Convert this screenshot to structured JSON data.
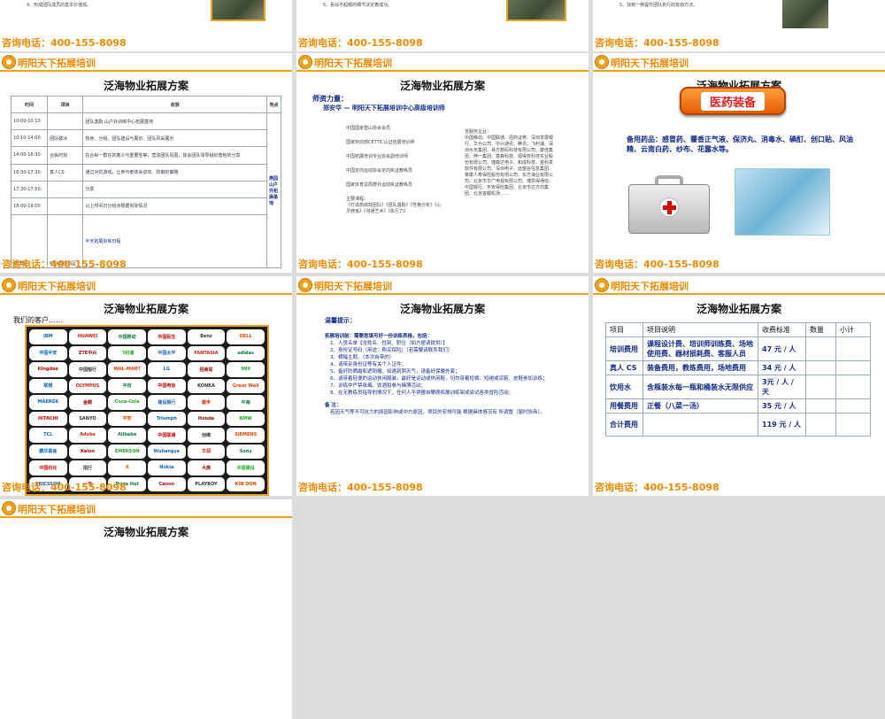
{
  "brand": "明阳天下拓展培训",
  "phone": "咨询电话：400-155-8098",
  "slide_title": "泛海物业拓展方案",
  "row0": {
    "s1_text": "4、形成团队成员的基本价值观。",
    "s2_text": "5、看似不起眼的细节决定着成功。",
    "s3_text": "5、找到一种提升团队执行的有效方法。"
  },
  "schedule": {
    "headers": [
      "时间",
      "项目",
      "收获",
      "地点"
    ],
    "side_label": "半天拓展训练日程",
    "rows": [
      [
        "10:00-10:10",
        "",
        "团队激励 山户外训练中心拓展基地",
        ""
      ],
      [
        "10:10-14:00",
        "团队破冰",
        "热身、分组、团队建设与展示、团队风采展示",
        ""
      ],
      [
        "14:00-16:30",
        "合纵时刻",
        "在合纵一群在的着义与重要性等，营造团队氛围，体会团队领导组织角色的分享",
        ""
      ],
      [
        "16:30-17:30",
        "真人CS",
        "通过对抗游戏，让参与者体会进攻、防御的策略",
        ""
      ],
      [
        "17:30-17:50",
        "",
        "分享",
        ""
      ],
      [
        "18:00-19:00",
        "",
        "以上时间日分班点根据实际情况",
        ""
      ]
    ],
    "place": "燕园山户外拓展基地",
    "end_time": "18:50",
    "end_text": "结队返回市区"
  },
  "trainer": {
    "section": "师资力量：",
    "name": "郑安华 — 明阳天下拓展培训中心高级培训师",
    "left_lines": [
      "中国国家登山协会会员",
      "国家劳动部CETTIC认证拓展培训师",
      "中国拓展培训专业协会副培训师",
      "中国定向运动协会定向执证教练员",
      "国家体育总局野外运动执证教练员"
    ],
    "courses_label": "主要课程：",
    "courses": "《打造高绩效团队》《团队激励》《性格分析》《心灵修炼》《沟通艺术》《执行力》",
    "right_head": "曾服务企业：",
    "right_text": "中国移动、中国联通、招商证券、深圳发展银行、华为公司、中兴通讯、腾讯、飞利浦、深圳水务集团、易方数码科技有限公司、康佳集团、伸一集团、富森科技、视得安科技实业股份有限公司、捷森达电子、和成科技、金科发软件有限公司、深圳电子、远望谷信息集团、泰康人寿保险股份有限公司、东方海业有限公司、北京市华广电视有限公司、博思得通信、中国银行、平安保险集团、北京市达方向集团、北京首都机场……"
  },
  "medical": {
    "button": "医药装备",
    "label": "备用药品：",
    "items": "感冒药、藿香正气液、保济丸、消毒水、碘酊、创口贴、风油精、云南白药、纱布、花露水等。"
  },
  "clients": {
    "heading": "我们的客户……",
    "logos": [
      "IBM",
      "HUAWEI",
      "中国移动",
      "中国民生",
      "Benz",
      "DELL",
      "中国平安",
      "ZTE中兴",
      "飞利浦",
      "中国太平",
      "FANTASIA",
      "adidas",
      "Kingdee",
      "中国银行",
      "WAL-MART",
      "LG",
      "招商局",
      "999",
      "联想",
      "OLYMPUS",
      "中信",
      "中国电信",
      "KONKA",
      "Great Wall",
      "MAERSK",
      "金蝶",
      "Coca-Cola",
      "建设银行",
      "顺丰",
      "中海",
      "HITACHI",
      "SANYO",
      "平安",
      "Triumph",
      "Honda",
      "BMW",
      "TCL",
      "Adobe",
      "Alibaba",
      "中国联通",
      "创维",
      "SIEMENS",
      "鹏华基金",
      "Kelon",
      "EMERSON",
      "Wuliangye",
      "华润",
      "Sony",
      "中国石化",
      "招行",
      "X",
      "Nokia",
      "大族",
      "中国建设",
      "ERICSSON",
      "一汽",
      "Pizza Hut",
      "Canon",
      "PLAYBOY",
      "KIN DON"
    ]
  },
  "notice": {
    "title": "温馨提示：",
    "subtitle": "拓展培训前：需要您填写好一份训练表格，包括：",
    "items": [
      "1、人员名单【含姓名、性别、职位（如方便请提供）】",
      "2、身份证号码（用途：购买保险）（若需要请联系我们）",
      "3、横幅主题。（本次自带的）",
      "4、请带足身份证等有关个人证件；",
      "5、备好防晒霜和遮阳帽，如遇到阴天气，请备好保暖外套；",
      "6、请穿着轻便的运动休闲服装，最好是运动或休闲鞋，切勿穿着短裤、短裙或凉鞋、皮鞋参加训练；",
      "7、训练中严禁吸烟、饮酒和参与赌博活动；",
      "8、在无教练员指导的情况下，任何人不得擅自攀爬拓展训练架或尝试各类冒险活动。"
    ],
    "note_label": "备 注：",
    "note": "若因天气等不可抗力的原因影响或中方原因，项目的安排可能 根据具体情况有  所调整（届时协商）。"
  },
  "fees": {
    "headers": [
      "项目",
      "项目说明",
      "收费标准",
      "数量",
      "小计"
    ],
    "rows": [
      [
        "培训费用",
        "课程设计费、培训师训练费、场地使用费、器材损耗费、客服人员",
        "47 元 / 人",
        "",
        ""
      ],
      [
        "真人 CS",
        "装备费用，教练费用，场地费用",
        "34 元 / 人",
        "",
        ""
      ],
      [
        "饮用水",
        "含瓶装水每一瓶和桶装水无限供应",
        "3元 / 人 / 天",
        "",
        ""
      ],
      [
        "用餐费用",
        "正餐（八菜一汤）",
        "35 元 / 人",
        "",
        ""
      ],
      [
        "合计费用",
        "",
        "119 元 / 人",
        "",
        ""
      ]
    ]
  }
}
